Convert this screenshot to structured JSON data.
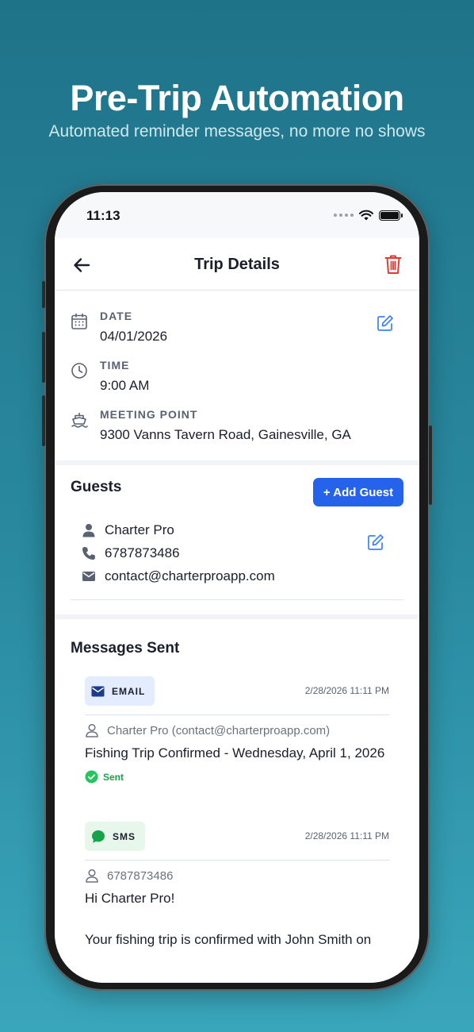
{
  "promo": {
    "title": "Pre-Trip Automation",
    "subtitle": "Automated reminder messages, no more no shows"
  },
  "status_bar": {
    "time": "11:13"
  },
  "nav": {
    "title": "Trip Details",
    "back_icon": "arrow-left-icon",
    "delete_icon": "trash-icon"
  },
  "details": {
    "date_label": "DATE",
    "date_value": "04/01/2026",
    "time_label": "TIME",
    "time_value": "9:00 AM",
    "meeting_label": "MEETING POINT",
    "meeting_value": "9300 Vanns Tavern Road, Gainesville, GA"
  },
  "guests": {
    "title": "Guests",
    "add_button": "+ Add Guest",
    "name": "Charter Pro",
    "phone": "6787873486",
    "email": "contact@charterproapp.com"
  },
  "messages": {
    "title": "Messages Sent",
    "items": [
      {
        "type": "EMAIL",
        "date": "2/28/2026 11:11 PM",
        "from": "Charter Pro (contact@charterproapp.com)",
        "text": "Fishing Trip Confirmed - Wednesday, April 1, 2026",
        "status": "Sent"
      },
      {
        "type": "SMS",
        "date": "2/28/2026 11:11 PM",
        "from": "6787873486",
        "text": "Hi Charter Pro!",
        "text2": "Your fishing trip is confirmed with John Smith on"
      }
    ]
  },
  "colors": {
    "accent": "#2563eb",
    "delete": "#e53935",
    "success": "#16a34a",
    "sms": "#16a34a"
  }
}
